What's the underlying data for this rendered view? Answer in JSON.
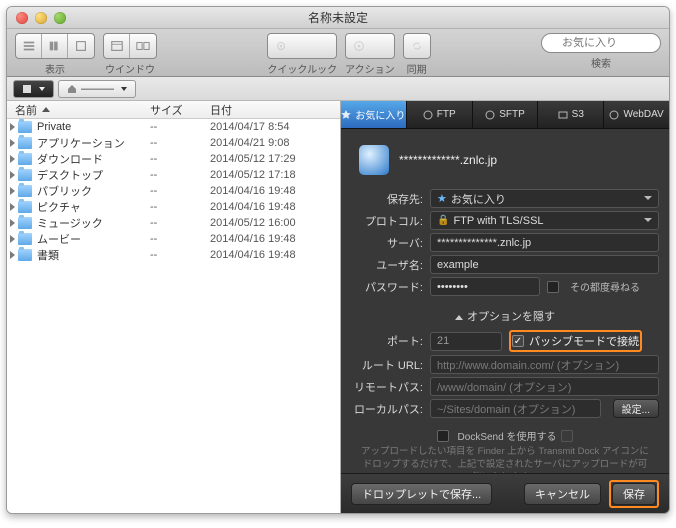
{
  "window_title": "名称未設定",
  "toolbar": {
    "view_label": "表示",
    "window_label": "ウインドウ",
    "quicklook_label": "クイックルック",
    "action_label": "アクション",
    "sync_label": "同期",
    "search_label": "検索",
    "search_placeholder": "お気に入り"
  },
  "path": {
    "current": "———"
  },
  "columns": {
    "name": "名前",
    "size": "サイズ",
    "date": "日付"
  },
  "files": [
    {
      "name": "Private",
      "size": "--",
      "date": "2014/04/17 8:54"
    },
    {
      "name": "アプリケーション",
      "size": "--",
      "date": "2014/04/21 9:08"
    },
    {
      "name": "ダウンロード",
      "size": "--",
      "date": "2014/05/12 17:29"
    },
    {
      "name": "デスクトップ",
      "size": "--",
      "date": "2014/05/12 17:18"
    },
    {
      "name": "パブリック",
      "size": "--",
      "date": "2014/04/16 19:48"
    },
    {
      "name": "ピクチャ",
      "size": "--",
      "date": "2014/04/16 19:48"
    },
    {
      "name": "ミュージック",
      "size": "--",
      "date": "2014/05/12 16:00"
    },
    {
      "name": "ムービー",
      "size": "--",
      "date": "2014/04/16 19:48"
    },
    {
      "name": "書類",
      "size": "--",
      "date": "2014/04/16 19:48"
    }
  ],
  "tabs": {
    "favorites": "お気に入り",
    "ftp": "FTP",
    "sftp": "SFTP",
    "s3": "S3",
    "webdav": "WebDAV"
  },
  "conn": {
    "hostname_masked": "*************.znlc.jp",
    "save_to_label": "保存先:",
    "save_to_value": "お気に入り",
    "protocol_label": "プロトコル:",
    "protocol_value": "FTP with TLS/SSL",
    "server_label": "サーバ:",
    "server_value": "**************.znlc.jp",
    "user_label": "ユーザ名:",
    "user_value": "example",
    "password_label": "パスワード:",
    "password_value": "••••••••",
    "ask_each_time": "その都度尋ねる",
    "options_hide": "オプションを隠す",
    "port_label": "ポート:",
    "port_value": "21",
    "passive_label": "パッシブモードで接続",
    "root_label": "ルート URL:",
    "root_ph": "http://www.domain.com/ (オプション)",
    "remote_label": "リモートパス:",
    "remote_ph": "/www/domain/ (オプション)",
    "local_label": "ローカルパス:",
    "local_ph": "~/Sites/domain (オプション)",
    "settings_btn": "設定...",
    "docksend": "DockSend を使用する",
    "hint": "アップロードしたい項目を Finder 上から Transmit Dock アイコンにドロップするだけで、上記で設定されたサーバにアップロードが可能になります。"
  },
  "footer": {
    "droplet": "ドロップレットで保存...",
    "cancel": "キャンセル",
    "save": "保存"
  }
}
